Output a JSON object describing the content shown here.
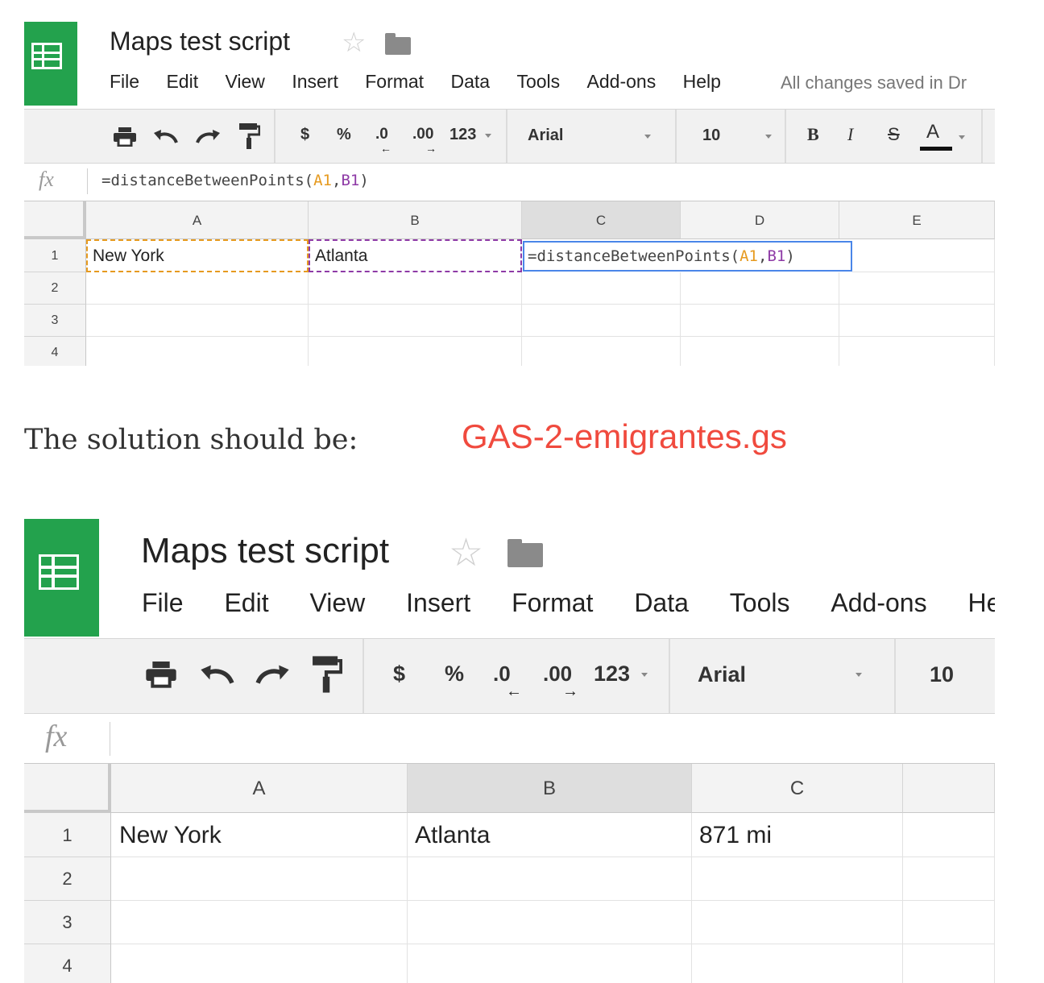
{
  "colors": {
    "brand_green": "#23a24d",
    "link_red": "#f04a3e",
    "ref_a": "#e69a1f",
    "ref_b": "#8e3aa6",
    "active_cell": "#4a86e8"
  },
  "top": {
    "title": "Maps test script",
    "star_icon": "☆",
    "menu": [
      "File",
      "Edit",
      "View",
      "Insert",
      "Format",
      "Data",
      "Tools",
      "Add-ons",
      "Help"
    ],
    "saved_status": "All changes saved in Dr",
    "toolbar": {
      "currency": "$",
      "percent": "%",
      "dec_less": ".0",
      "dec_more": ".00",
      "number_format": "123",
      "font": "Arial",
      "size": "10",
      "bold": "B",
      "italic": "I",
      "strike": "S",
      "text_color": "A"
    },
    "fx": "fx",
    "formula_prefix": "=distanceBetweenPoints(",
    "formula_ref_a": "A1",
    "formula_comma": ",",
    "formula_ref_b": "B1",
    "formula_suffix": ")",
    "columns": [
      "A",
      "B",
      "C",
      "D",
      "E"
    ],
    "rows": [
      "1",
      "2",
      "3",
      "4"
    ],
    "cells": {
      "a1": "New York",
      "b1": "Atlanta"
    }
  },
  "caption": "The solution should be:",
  "link": "GAS-2-emigrantes.gs",
  "bottom": {
    "title": "Maps test script",
    "star_icon": "☆",
    "menu": [
      "File",
      "Edit",
      "View",
      "Insert",
      "Format",
      "Data",
      "Tools",
      "Add-ons",
      "Help"
    ],
    "toolbar": {
      "currency": "$",
      "percent": "%",
      "dec_less": ".0",
      "dec_more": ".00",
      "number_format": "123",
      "font": "Arial",
      "size": "10"
    },
    "fx": "fx",
    "columns": [
      "A",
      "B",
      "C"
    ],
    "rows": [
      "1",
      "2",
      "3",
      "4"
    ],
    "cells": {
      "a1": "New York",
      "b1": "Atlanta",
      "c1": "871 mi"
    }
  }
}
